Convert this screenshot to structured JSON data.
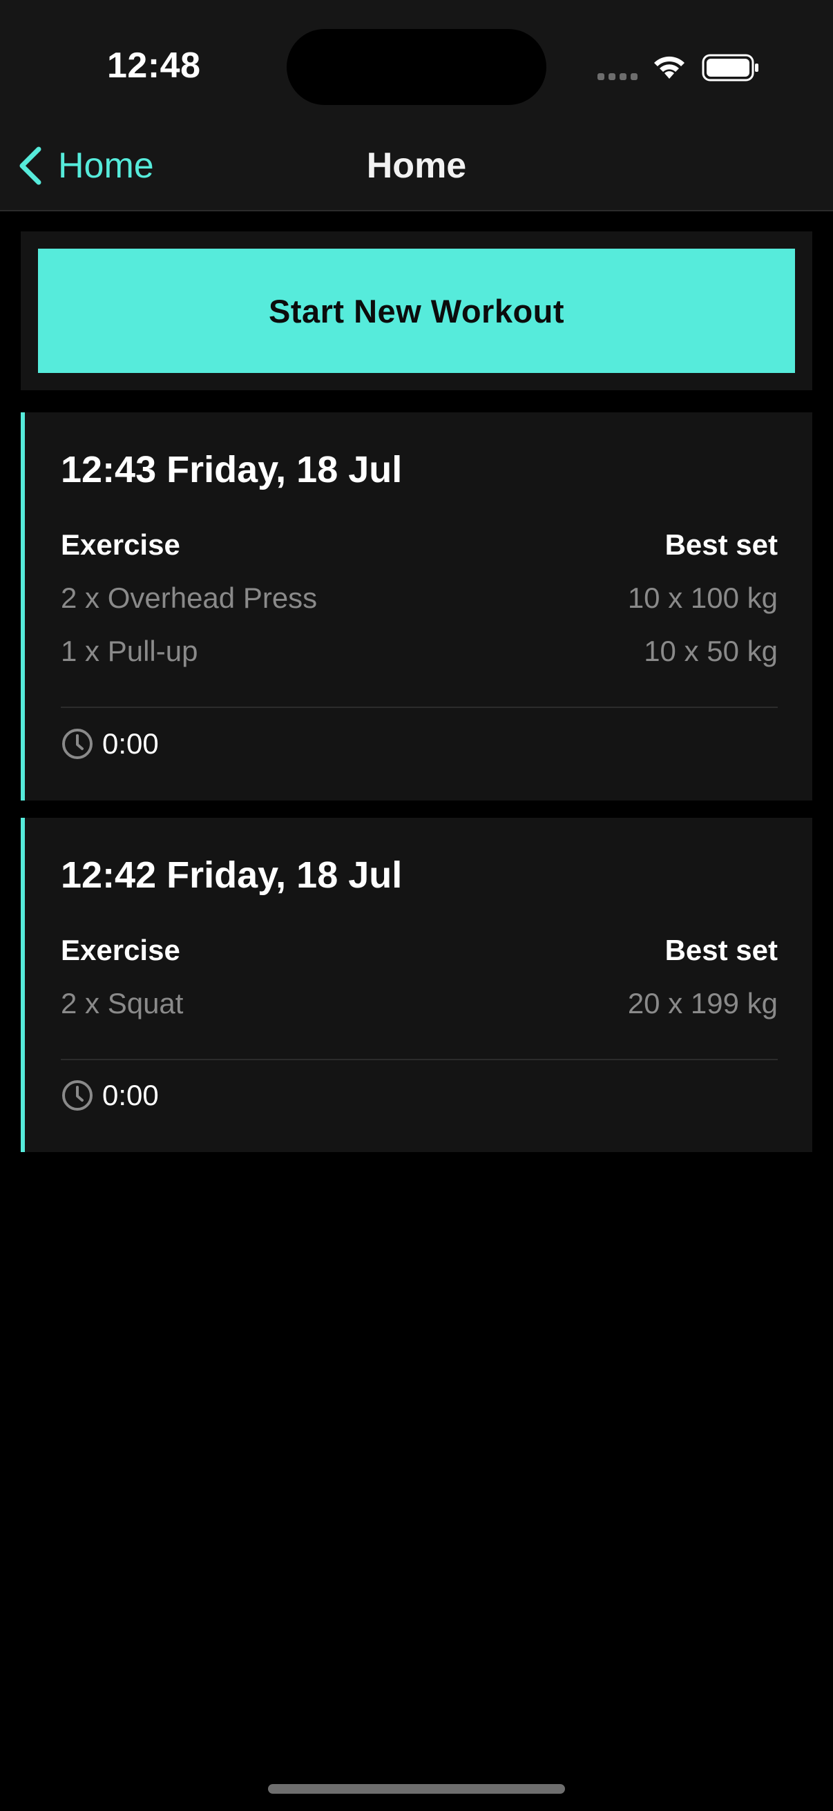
{
  "status_bar": {
    "time": "12:48"
  },
  "nav": {
    "back_label": "Home",
    "title": "Home"
  },
  "start_button_label": "Start New Workout",
  "colors": {
    "accent": "#56ebdb",
    "card_background": "#141414",
    "muted_text": "#8a8a8a"
  },
  "workouts": [
    {
      "title": "12:43 Friday, 18 Jul",
      "exercise_header": "Exercise",
      "best_set_header": "Best set",
      "rows": [
        {
          "exercise": "2 x Overhead Press",
          "best_set": "10 x 100 kg"
        },
        {
          "exercise": "1 x Pull-up",
          "best_set": "10 x 50 kg"
        }
      ],
      "duration": "0:00"
    },
    {
      "title": "12:42 Friday, 18 Jul",
      "exercise_header": "Exercise",
      "best_set_header": "Best set",
      "rows": [
        {
          "exercise": "2 x Squat",
          "best_set": "20 x 199 kg"
        }
      ],
      "duration": "0:00"
    }
  ]
}
